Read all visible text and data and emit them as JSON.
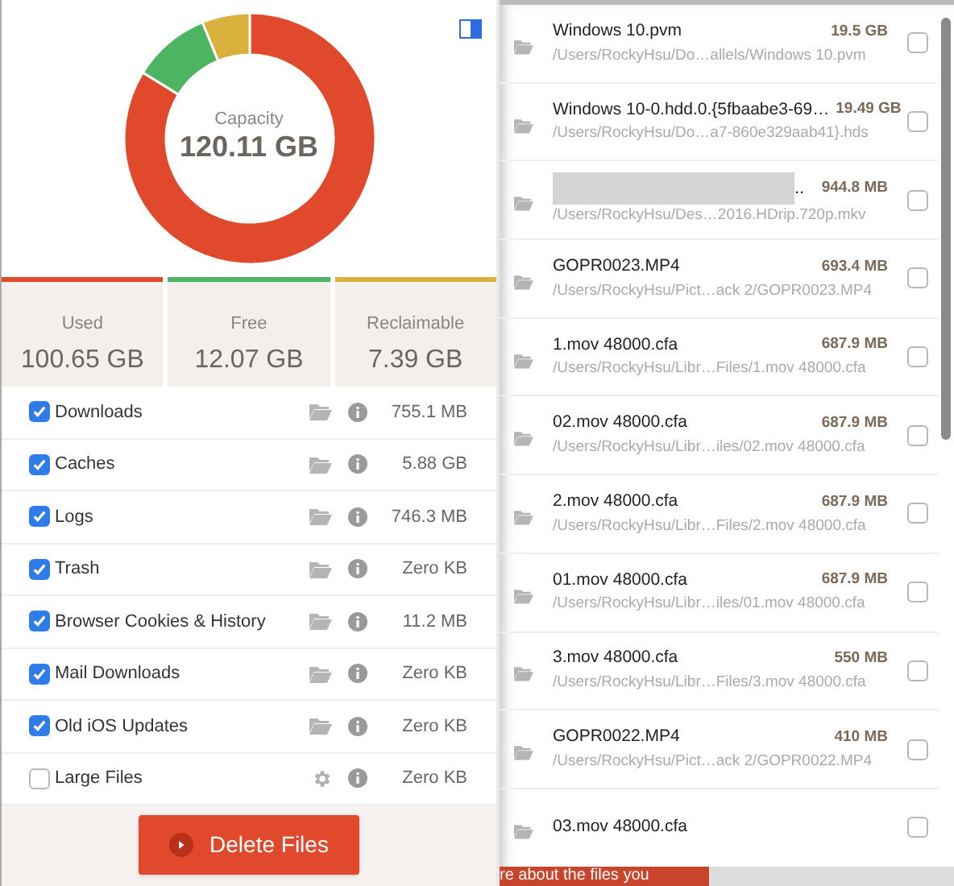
{
  "capacity": {
    "label": "Capacity",
    "value": "120.11 GB"
  },
  "chart_data": {
    "type": "donut",
    "values": [
      83.8,
      10.05,
      6.15
    ],
    "colors": [
      "#e0492b",
      "#4db463",
      "#d9b03c"
    ]
  },
  "stats": [
    {
      "label": "Used",
      "value": "100.65 GB",
      "color": "#e0492b"
    },
    {
      "label": "Free",
      "value": "12.07 GB",
      "color": "#4db463"
    },
    {
      "label": "Reclaimable",
      "value": "7.39 GB",
      "color": "#d9b03c"
    }
  ],
  "categories": [
    {
      "label": "Downloads",
      "checked": true,
      "kind": "folder",
      "size": "755.1 MB"
    },
    {
      "label": "Caches",
      "checked": true,
      "kind": "folder",
      "size": "5.88 GB"
    },
    {
      "label": "Logs",
      "checked": true,
      "kind": "folder",
      "size": "746.3 MB"
    },
    {
      "label": "Trash",
      "checked": true,
      "kind": "folder",
      "size": "Zero KB"
    },
    {
      "label": "Browser Cookies & History",
      "checked": true,
      "kind": "folder",
      "size": "11.2 MB"
    },
    {
      "label": "Mail Downloads",
      "checked": true,
      "kind": "folder",
      "size": "Zero KB"
    },
    {
      "label": "Old iOS Updates",
      "checked": true,
      "kind": "folder",
      "size": "Zero KB"
    },
    {
      "label": "Large Files",
      "checked": false,
      "kind": "settings",
      "size": "Zero KB"
    }
  ],
  "delete_button": "Delete Files",
  "files": [
    {
      "name": "Windows 10.pvm",
      "size": "19.5 GB",
      "path": "/Users/RockyHsu/Do…allels/Windows 10.pvm",
      "blurred": false,
      "checked": false
    },
    {
      "name": "Windows 10-0.hdd.0.{5fbaabe3-69…",
      "size": "19.49 GB",
      "path": "/Users/RockyHsu/Do…a7-860e329aab41}.hds",
      "blurred": false,
      "checked": false
    },
    {
      "name": "..",
      "size": "944.8 MB",
      "path": "/Users/RockyHsu/Des…2016.HDrip.720p.mkv",
      "blurred": true,
      "checked": false
    },
    {
      "name": "GOPR0023.MP4",
      "size": "693.4 MB",
      "path": "/Users/RockyHsu/Pict…ack 2/GOPR0023.MP4",
      "blurred": false,
      "checked": false
    },
    {
      "name": "1.mov 48000.cfa",
      "size": "687.9 MB",
      "path": "/Users/RockyHsu/Libr…Files/1.mov 48000.cfa",
      "blurred": false,
      "checked": false
    },
    {
      "name": "02.mov 48000.cfa",
      "size": "687.9 MB",
      "path": "/Users/RockyHsu/Libr…iles/02.mov 48000.cfa",
      "blurred": false,
      "checked": false
    },
    {
      "name": "2.mov 48000.cfa",
      "size": "687.9 MB",
      "path": "/Users/RockyHsu/Libr…Files/2.mov 48000.cfa",
      "blurred": false,
      "checked": false
    },
    {
      "name": "01.mov 48000.cfa",
      "size": "687.9 MB",
      "path": "/Users/RockyHsu/Libr…iles/01.mov 48000.cfa",
      "blurred": false,
      "checked": false
    },
    {
      "name": "3.mov 48000.cfa",
      "size": "550 MB",
      "path": "/Users/RockyHsu/Libr…Files/3.mov 48000.cfa",
      "blurred": false,
      "checked": false
    },
    {
      "name": "GOPR0022.MP4",
      "size": "410 MB",
      "path": "/Users/RockyHsu/Pict…ack 2/GOPR0022.MP4",
      "blurred": false,
      "checked": false
    },
    {
      "name": "03.mov 48000.cfa",
      "blurred": false,
      "checked": false
    }
  ],
  "footer_text": "re about the files you"
}
